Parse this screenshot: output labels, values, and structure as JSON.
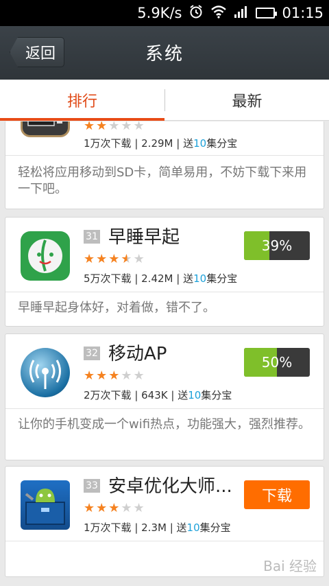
{
  "status_bar": {
    "speed": "5.9K/s",
    "time": "01:15",
    "icons": [
      "alarm-icon",
      "wifi-icon",
      "signal-icon",
      "battery-icon"
    ]
  },
  "title_bar": {
    "back_label": "返回",
    "title": "系统"
  },
  "tabs": [
    {
      "label": "排行",
      "active": true
    },
    {
      "label": "最新",
      "active": false
    }
  ],
  "apps": [
    {
      "rank": "",
      "name": "",
      "rating": 2,
      "downloads": "1万次下载",
      "size": "2.29M",
      "bonus_prefix": "送",
      "bonus_num": "10",
      "bonus_suffix": "集分宝",
      "description": "轻松将应用移动到SD卡，简单易用，不妨下载下来用一下吧。",
      "icon": "sd-card-icon"
    },
    {
      "rank": "31",
      "name": "早睡早起",
      "rating": 3.5,
      "downloads": "5万次下载",
      "size": "2.42M",
      "bonus_prefix": "送",
      "bonus_num": "10",
      "bonus_suffix": "集分宝",
      "description": "早睡早起身体好，对着做，错不了。",
      "progress": 0.39,
      "progress_label": "39%",
      "icon": "clock-face-icon"
    },
    {
      "rank": "32",
      "name": "移动AP",
      "rating": 3,
      "downloads": "2万次下载",
      "size": "643K",
      "bonus_prefix": "送",
      "bonus_num": "10",
      "bonus_suffix": "集分宝",
      "description": "让你的手机变成一个wifi热点，功能强大，强烈推荐。",
      "progress": 0.5,
      "progress_label": "50%",
      "icon": "wifi-hotspot-icon"
    },
    {
      "rank": "33",
      "name": "安卓优化大师...",
      "rating": 3,
      "downloads": "1万次下载",
      "size": "2.3M",
      "bonus_prefix": "送",
      "bonus_num": "10",
      "bonus_suffix": "集分宝",
      "description": "",
      "action_label": "下载",
      "icon": "android-toolbox-icon"
    }
  ],
  "meta_separator": " | ",
  "watermark": "Bai 经验",
  "colors": {
    "accent": "#e84c17",
    "progress": "#7fbf2a",
    "download": "#ff6d00",
    "star": "#f58220",
    "highlight": "#1ea1d9"
  }
}
